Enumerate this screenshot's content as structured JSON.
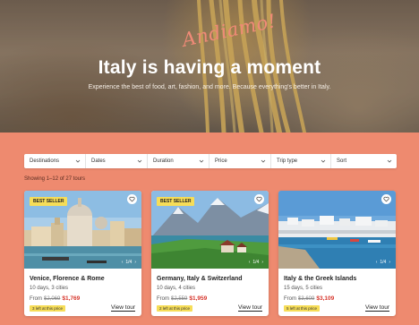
{
  "hero": {
    "script": "Andiamo!",
    "title": "Italy is having a moment",
    "subtitle": "Experience the best of food, art, fashion, and more. Because everything's better in Italy."
  },
  "filters": [
    {
      "label": "Destinations"
    },
    {
      "label": "Dates"
    },
    {
      "label": "Duration"
    },
    {
      "label": "Price"
    },
    {
      "label": "Trip type"
    },
    {
      "label": "Sort"
    }
  ],
  "results_text": "Showing 1–12 of 27 tours",
  "colors": {
    "page_bg": "#ee8a6f",
    "badge": "#f6dd58",
    "sale_price": "#d6342a"
  },
  "cards": [
    {
      "badge": "BEST SELLER",
      "pager": "1/4",
      "title": "Venice, Florence & Rome",
      "meta": "10 days, 3 cities",
      "from": "From",
      "old_price": "$2,069",
      "new_price": "$1,769",
      "left": "3 left at this price",
      "cta": "View tour"
    },
    {
      "badge": "BEST SELLER",
      "pager": "1/4",
      "title": "Germany, Italy & Switzerland",
      "meta": "10 days, 4 cities",
      "from": "From",
      "old_price": "$2,559",
      "new_price": "$1,959",
      "left": "2 left at this price",
      "cta": "View tour"
    },
    {
      "badge": "",
      "pager": "1/4",
      "title": "Italy & the Greek Islands",
      "meta": "15 days, 5 cities",
      "from": "From",
      "old_price": "$3,609",
      "new_price": "$3,109",
      "left": "5 left at this price",
      "cta": "View tour"
    }
  ]
}
